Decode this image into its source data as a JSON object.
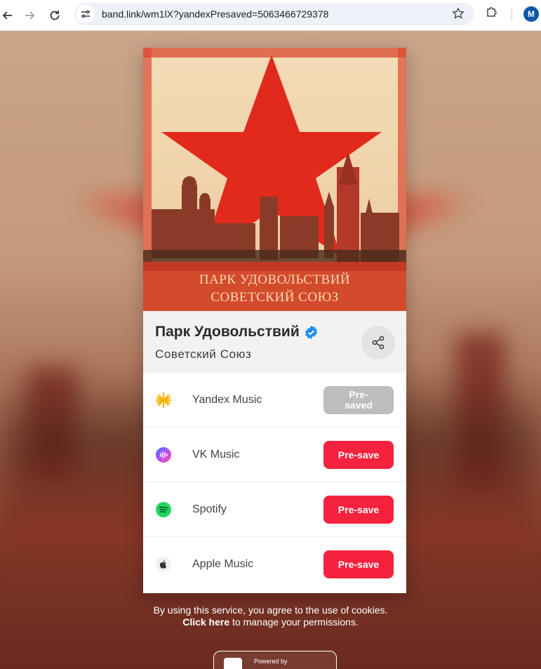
{
  "browser": {
    "url": "band.link/wm1lX?yandexPresaved=5063466729378",
    "profile_initial": "M"
  },
  "release": {
    "artist": "Парк Удовольствий",
    "album": "Советский Союз",
    "cover_text_line1": "ПАРК УДОВОЛЬСТВИЙ",
    "cover_text_line2": "СОВЕТСКИЙ СОЮЗ"
  },
  "services": [
    {
      "name": "Yandex Music",
      "icon": "yandex-music-icon",
      "button": "Pre-saved",
      "state": "saved"
    },
    {
      "name": "VK Music",
      "icon": "vk-music-icon",
      "button": "Pre-save",
      "state": "available"
    },
    {
      "name": "Spotify",
      "icon": "spotify-icon",
      "button": "Pre-save",
      "state": "available"
    },
    {
      "name": "Apple Music",
      "icon": "apple-music-icon",
      "button": "Pre-save",
      "state": "available"
    }
  ],
  "cookie": {
    "line1": "By using this service, you agree to the use of cookies.",
    "link": "Click here",
    "line2_rest": " to manage your permissions."
  },
  "footer": {
    "powered_by": "Powered by"
  },
  "colors": {
    "accent": "#f5223e",
    "saved": "#bdbdbd",
    "verified": "#1d8ef0"
  }
}
